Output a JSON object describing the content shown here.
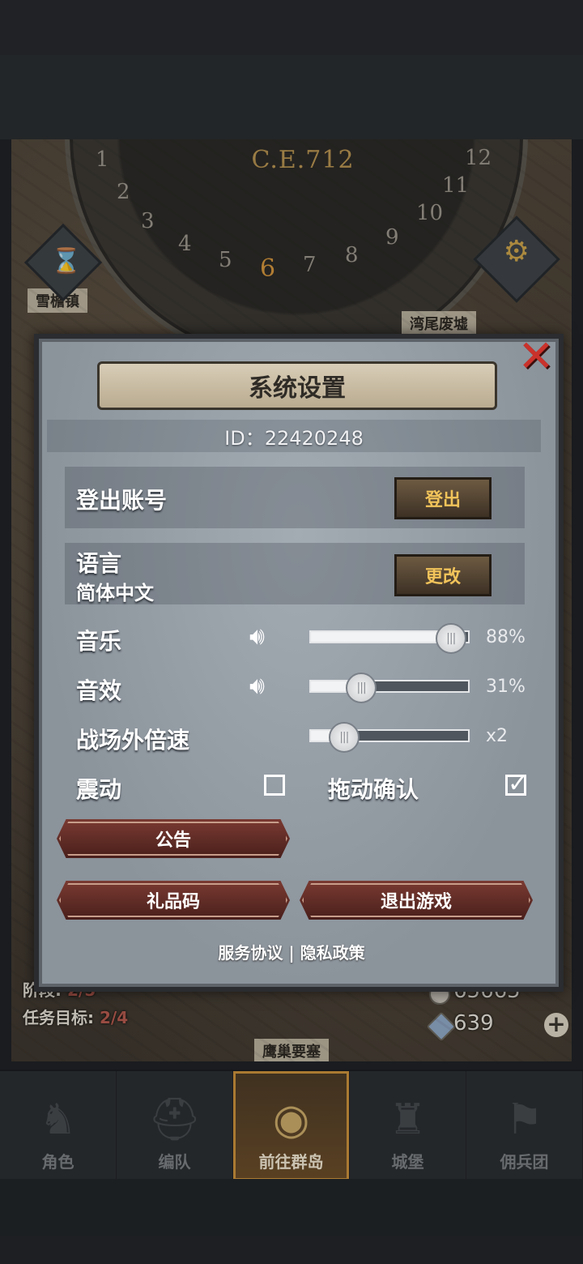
{
  "map": {
    "year": "C.E.712",
    "dial_numbers": [
      "1",
      "2",
      "3",
      "4",
      "5",
      "6",
      "7",
      "8",
      "9",
      "10",
      "11",
      "12"
    ],
    "active_month": "6",
    "label_left": "雪檐镇",
    "label_right": "湾尾废墟",
    "label_bottom": "鹰巢要塞",
    "stage_label": "阶段:",
    "stage_value": "2/5",
    "task_label": "任务目标:",
    "task_value": "2/4",
    "silver": "65665",
    "crystal": "639"
  },
  "dialog": {
    "title": "系统设置",
    "id_text": "ID：22420248",
    "logout_label": "登出账号",
    "logout_button": "登出",
    "language_label": "语言",
    "language_value": "简体中文",
    "change_button": "更改",
    "music_label": "音乐",
    "music_value": "88%",
    "music_level": 0.88,
    "sfx_label": "音效",
    "sfx_value": "31%",
    "sfx_level": 0.31,
    "speed_label": "战场外倍速",
    "speed_value": "x2",
    "speed_level": 0.2,
    "vibration_label": "震动",
    "vibration_checked": false,
    "drag_confirm_label": "拖动确认",
    "drag_confirm_checked": true,
    "notice_button": "公告",
    "gift_code_button": "礼品码",
    "exit_button": "退出游戏",
    "footer_service": "服务协议",
    "footer_sep": "|",
    "footer_privacy": "隐私政策"
  },
  "nav": {
    "items": [
      {
        "label": "角色",
        "icon": "character-icon"
      },
      {
        "label": "编队",
        "icon": "helmet-icon"
      },
      {
        "label": "前往群岛",
        "icon": "islands-icon"
      },
      {
        "label": "城堡",
        "icon": "castle-icon"
      },
      {
        "label": "佣兵团",
        "icon": "mercenary-icon"
      }
    ],
    "active_index": 2
  }
}
